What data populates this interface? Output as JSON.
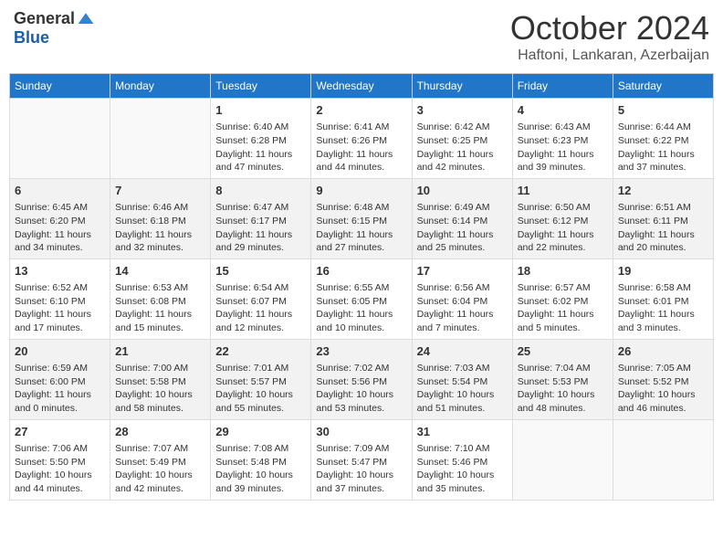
{
  "header": {
    "logo_general": "General",
    "logo_blue": "Blue",
    "month_title": "October 2024",
    "subtitle": "Haftoni, Lankaran, Azerbaijan"
  },
  "days_of_week": [
    "Sunday",
    "Monday",
    "Tuesday",
    "Wednesday",
    "Thursday",
    "Friday",
    "Saturday"
  ],
  "weeks": [
    [
      {
        "day": "",
        "sunrise": "",
        "sunset": "",
        "daylight": ""
      },
      {
        "day": "",
        "sunrise": "",
        "sunset": "",
        "daylight": ""
      },
      {
        "day": "1",
        "sunrise": "Sunrise: 6:40 AM",
        "sunset": "Sunset: 6:28 PM",
        "daylight": "Daylight: 11 hours and 47 minutes."
      },
      {
        "day": "2",
        "sunrise": "Sunrise: 6:41 AM",
        "sunset": "Sunset: 6:26 PM",
        "daylight": "Daylight: 11 hours and 44 minutes."
      },
      {
        "day": "3",
        "sunrise": "Sunrise: 6:42 AM",
        "sunset": "Sunset: 6:25 PM",
        "daylight": "Daylight: 11 hours and 42 minutes."
      },
      {
        "day": "4",
        "sunrise": "Sunrise: 6:43 AM",
        "sunset": "Sunset: 6:23 PM",
        "daylight": "Daylight: 11 hours and 39 minutes."
      },
      {
        "day": "5",
        "sunrise": "Sunrise: 6:44 AM",
        "sunset": "Sunset: 6:22 PM",
        "daylight": "Daylight: 11 hours and 37 minutes."
      }
    ],
    [
      {
        "day": "6",
        "sunrise": "Sunrise: 6:45 AM",
        "sunset": "Sunset: 6:20 PM",
        "daylight": "Daylight: 11 hours and 34 minutes."
      },
      {
        "day": "7",
        "sunrise": "Sunrise: 6:46 AM",
        "sunset": "Sunset: 6:18 PM",
        "daylight": "Daylight: 11 hours and 32 minutes."
      },
      {
        "day": "8",
        "sunrise": "Sunrise: 6:47 AM",
        "sunset": "Sunset: 6:17 PM",
        "daylight": "Daylight: 11 hours and 29 minutes."
      },
      {
        "day": "9",
        "sunrise": "Sunrise: 6:48 AM",
        "sunset": "Sunset: 6:15 PM",
        "daylight": "Daylight: 11 hours and 27 minutes."
      },
      {
        "day": "10",
        "sunrise": "Sunrise: 6:49 AM",
        "sunset": "Sunset: 6:14 PM",
        "daylight": "Daylight: 11 hours and 25 minutes."
      },
      {
        "day": "11",
        "sunrise": "Sunrise: 6:50 AM",
        "sunset": "Sunset: 6:12 PM",
        "daylight": "Daylight: 11 hours and 22 minutes."
      },
      {
        "day": "12",
        "sunrise": "Sunrise: 6:51 AM",
        "sunset": "Sunset: 6:11 PM",
        "daylight": "Daylight: 11 hours and 20 minutes."
      }
    ],
    [
      {
        "day": "13",
        "sunrise": "Sunrise: 6:52 AM",
        "sunset": "Sunset: 6:10 PM",
        "daylight": "Daylight: 11 hours and 17 minutes."
      },
      {
        "day": "14",
        "sunrise": "Sunrise: 6:53 AM",
        "sunset": "Sunset: 6:08 PM",
        "daylight": "Daylight: 11 hours and 15 minutes."
      },
      {
        "day": "15",
        "sunrise": "Sunrise: 6:54 AM",
        "sunset": "Sunset: 6:07 PM",
        "daylight": "Daylight: 11 hours and 12 minutes."
      },
      {
        "day": "16",
        "sunrise": "Sunrise: 6:55 AM",
        "sunset": "Sunset: 6:05 PM",
        "daylight": "Daylight: 11 hours and 10 minutes."
      },
      {
        "day": "17",
        "sunrise": "Sunrise: 6:56 AM",
        "sunset": "Sunset: 6:04 PM",
        "daylight": "Daylight: 11 hours and 7 minutes."
      },
      {
        "day": "18",
        "sunrise": "Sunrise: 6:57 AM",
        "sunset": "Sunset: 6:02 PM",
        "daylight": "Daylight: 11 hours and 5 minutes."
      },
      {
        "day": "19",
        "sunrise": "Sunrise: 6:58 AM",
        "sunset": "Sunset: 6:01 PM",
        "daylight": "Daylight: 11 hours and 3 minutes."
      }
    ],
    [
      {
        "day": "20",
        "sunrise": "Sunrise: 6:59 AM",
        "sunset": "Sunset: 6:00 PM",
        "daylight": "Daylight: 11 hours and 0 minutes."
      },
      {
        "day": "21",
        "sunrise": "Sunrise: 7:00 AM",
        "sunset": "Sunset: 5:58 PM",
        "daylight": "Daylight: 10 hours and 58 minutes."
      },
      {
        "day": "22",
        "sunrise": "Sunrise: 7:01 AM",
        "sunset": "Sunset: 5:57 PM",
        "daylight": "Daylight: 10 hours and 55 minutes."
      },
      {
        "day": "23",
        "sunrise": "Sunrise: 7:02 AM",
        "sunset": "Sunset: 5:56 PM",
        "daylight": "Daylight: 10 hours and 53 minutes."
      },
      {
        "day": "24",
        "sunrise": "Sunrise: 7:03 AM",
        "sunset": "Sunset: 5:54 PM",
        "daylight": "Daylight: 10 hours and 51 minutes."
      },
      {
        "day": "25",
        "sunrise": "Sunrise: 7:04 AM",
        "sunset": "Sunset: 5:53 PM",
        "daylight": "Daylight: 10 hours and 48 minutes."
      },
      {
        "day": "26",
        "sunrise": "Sunrise: 7:05 AM",
        "sunset": "Sunset: 5:52 PM",
        "daylight": "Daylight: 10 hours and 46 minutes."
      }
    ],
    [
      {
        "day": "27",
        "sunrise": "Sunrise: 7:06 AM",
        "sunset": "Sunset: 5:50 PM",
        "daylight": "Daylight: 10 hours and 44 minutes."
      },
      {
        "day": "28",
        "sunrise": "Sunrise: 7:07 AM",
        "sunset": "Sunset: 5:49 PM",
        "daylight": "Daylight: 10 hours and 42 minutes."
      },
      {
        "day": "29",
        "sunrise": "Sunrise: 7:08 AM",
        "sunset": "Sunset: 5:48 PM",
        "daylight": "Daylight: 10 hours and 39 minutes."
      },
      {
        "day": "30",
        "sunrise": "Sunrise: 7:09 AM",
        "sunset": "Sunset: 5:47 PM",
        "daylight": "Daylight: 10 hours and 37 minutes."
      },
      {
        "day": "31",
        "sunrise": "Sunrise: 7:10 AM",
        "sunset": "Sunset: 5:46 PM",
        "daylight": "Daylight: 10 hours and 35 minutes."
      },
      {
        "day": "",
        "sunrise": "",
        "sunset": "",
        "daylight": ""
      },
      {
        "day": "",
        "sunrise": "",
        "sunset": "",
        "daylight": ""
      }
    ]
  ]
}
